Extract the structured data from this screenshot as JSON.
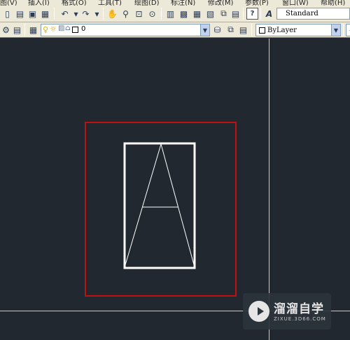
{
  "menu": [
    {
      "label": "图(V)"
    },
    {
      "label": "插入(I)"
    },
    {
      "label": "格式(O)"
    },
    {
      "label": "工具(T)"
    },
    {
      "label": "绘图(D)"
    },
    {
      "label": "标注(N)"
    },
    {
      "label": "修改(M)"
    },
    {
      "label": "参数(P)"
    },
    {
      "label": "窗口(W)"
    },
    {
      "label": "帮助(H)"
    }
  ],
  "toolbar": {
    "text_style": "Standard",
    "layer_name": "0",
    "color_value": "ByLayer"
  },
  "icons": {
    "new": "new-file-icon",
    "open": "open-file-icon",
    "save": "save-icon",
    "undo": "undo-icon",
    "redo": "redo-icon",
    "pan": "pan-hand-icon",
    "zoom": "zoom-icon",
    "help": "help-icon",
    "text_style": "text-style-icon",
    "layer": "layer-icon"
  },
  "canvas": {
    "background": "#212830",
    "highlight_color": "#c01010",
    "drawing_color": "#ffffff"
  },
  "watermark": {
    "title": "溜溜自学",
    "url": "ZIXUE.3D66.COM"
  }
}
